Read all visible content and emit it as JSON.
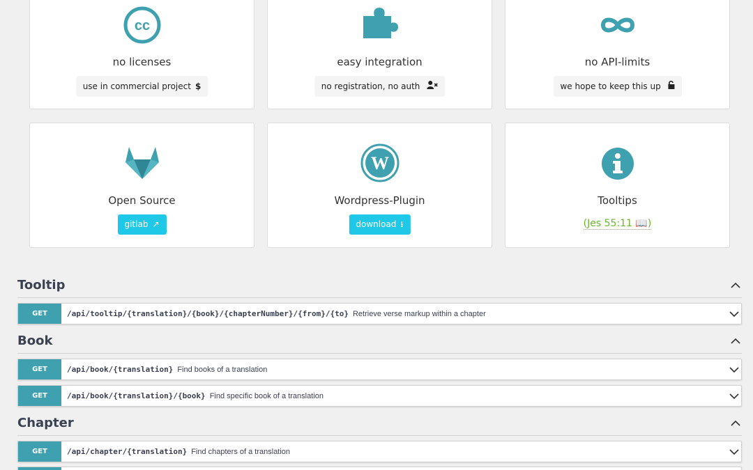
{
  "colors": {
    "accent": "#3fa1b0",
    "button": "#1fc8e6",
    "link_green": "#6cb52d"
  },
  "features": [
    {
      "icon": "creative-commons-icon",
      "title": "no licenses",
      "pill": "use in commercial project",
      "pill_icon": "dollar-icon"
    },
    {
      "icon": "puzzle-piece-icon",
      "title": "easy integration",
      "pill": "no registration, no auth",
      "pill_icon": "user-times-icon"
    },
    {
      "icon": "infinity-icon",
      "title": "no API-limits",
      "pill": "we hope to keep this up",
      "pill_icon": "unlock-icon"
    },
    {
      "icon": "gitlab-icon",
      "title": "Open Source",
      "button": "gitlab",
      "button_icon": "external-link-icon"
    },
    {
      "icon": "wordpress-icon",
      "title": "Wordpress-Plugin",
      "button": "download",
      "button_icon": "download-icon"
    },
    {
      "icon": "info-circle-icon",
      "title": "Tooltips",
      "link": "(Jes 55:11 📖)"
    }
  ],
  "sections": [
    {
      "name": "Tooltip",
      "ops": [
        {
          "method": "GET",
          "path": "/api/tooltip/{translation}/{book}/{chapterNumber}/{from}/{to}",
          "summary": "Retrieve verse markup within a chapter"
        }
      ]
    },
    {
      "name": "Book",
      "ops": [
        {
          "method": "GET",
          "path": "/api/book/{translation}",
          "summary": "Find books of a translation"
        },
        {
          "method": "GET",
          "path": "/api/book/{translation}/{book}",
          "summary": "Find specific book of a translation"
        }
      ]
    },
    {
      "name": "Chapter",
      "ops": [
        {
          "method": "GET",
          "path": "/api/chapter/{translation}",
          "summary": "Find chapters of a translation"
        }
      ]
    }
  ]
}
